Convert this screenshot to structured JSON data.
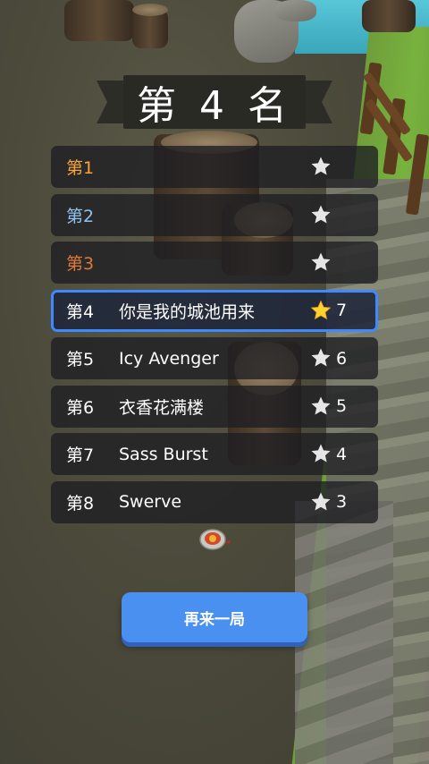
{
  "title": "第 4 名",
  "colors": {
    "rank1": "#f5a53a",
    "rank2": "#8fc3f0",
    "rank3": "#e0783a",
    "default": "#ffffff",
    "highlight_border": "#3f88ff",
    "gold_star": "#ffd22e",
    "gray_star": "#e6e6e6",
    "button": "#4a90f0"
  },
  "rankings": [
    {
      "rank": "第1",
      "name": "",
      "star": "gray-star-icon",
      "score": ""
    },
    {
      "rank": "第2",
      "name": "",
      "star": "gray-star-icon",
      "score": ""
    },
    {
      "rank": "第3",
      "name": "",
      "star": "gray-star-icon",
      "score": ""
    },
    {
      "rank": "第4",
      "name": "你是我的城池用来",
      "star": "gold-star-icon",
      "score": "7"
    },
    {
      "rank": "第5",
      "name": "Icy Avenger",
      "star": "gray-star-icon",
      "score": "6"
    },
    {
      "rank": "第6",
      "name": "衣香花满楼",
      "star": "gray-star-icon",
      "score": "5"
    },
    {
      "rank": "第7",
      "name": "Sass Burst",
      "star": "gray-star-icon",
      "score": "4"
    },
    {
      "rank": "第8",
      "name": "Swerve",
      "star": "gray-star-icon",
      "score": "3"
    }
  ],
  "replay_button": "再来一局",
  "player_icon": "spinning-top-icon"
}
